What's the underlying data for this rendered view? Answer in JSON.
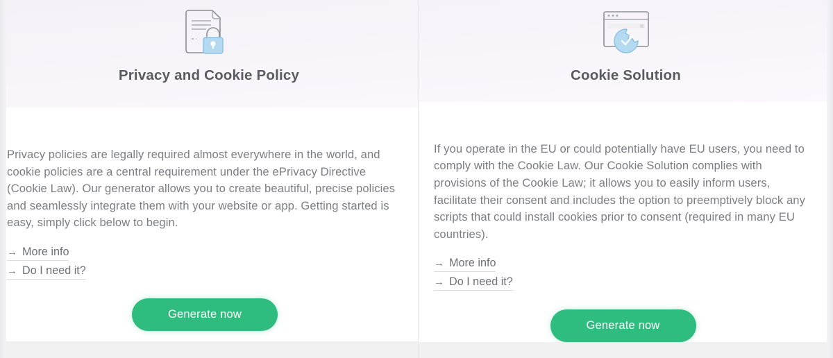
{
  "theme": {
    "header_background": "#f6f4f8",
    "body_background": "#ffffff",
    "title_color": "#595b5e",
    "text_color": "#7b7d80",
    "link_color": "#6e7073",
    "divider_color": "#e6e6e9",
    "cta_color": "#2ebd7e",
    "cta_text_color": "#ffffff",
    "icon_line_color": "#8d9095",
    "icon_accent_color": "#b3daf0"
  },
  "panels": [
    {
      "id": "privacy-and-cookie-policy",
      "icon_name": "document-with-lock-icon",
      "title": "Privacy and Cookie Policy",
      "description": "Privacy policies are legally required almost everywhere in the world, and cookie policies are a central requirement under the ePrivacy Directive (Cookie Law). Our generator allows you to create beautiful, precise policies and seamlessly integrate them with your website or app. Getting started is easy, simply click below to begin.",
      "links": [
        {
          "arrow": "→",
          "label": "More info"
        },
        {
          "arrow": "→",
          "label": "Do I need it?"
        }
      ],
      "cta_label": "Generate now"
    },
    {
      "id": "cookie-solution",
      "icon_name": "browser-window-with-cookie-icon",
      "title": "Cookie Solution",
      "description": "If you operate in the EU or could potentially have EU users, you need to comply with the Cookie Law. Our Cookie Solution complies with provisions of the Cookie Law; it allows you to easily inform users, facilitate their consent and includes the option to preemptively block any scripts that could install cookies prior to consent (required in many EU countries).",
      "links": [
        {
          "arrow": "→",
          "label": "More info"
        },
        {
          "arrow": "→",
          "label": "Do I need it?"
        }
      ],
      "cta_label": "Generate now"
    }
  ]
}
